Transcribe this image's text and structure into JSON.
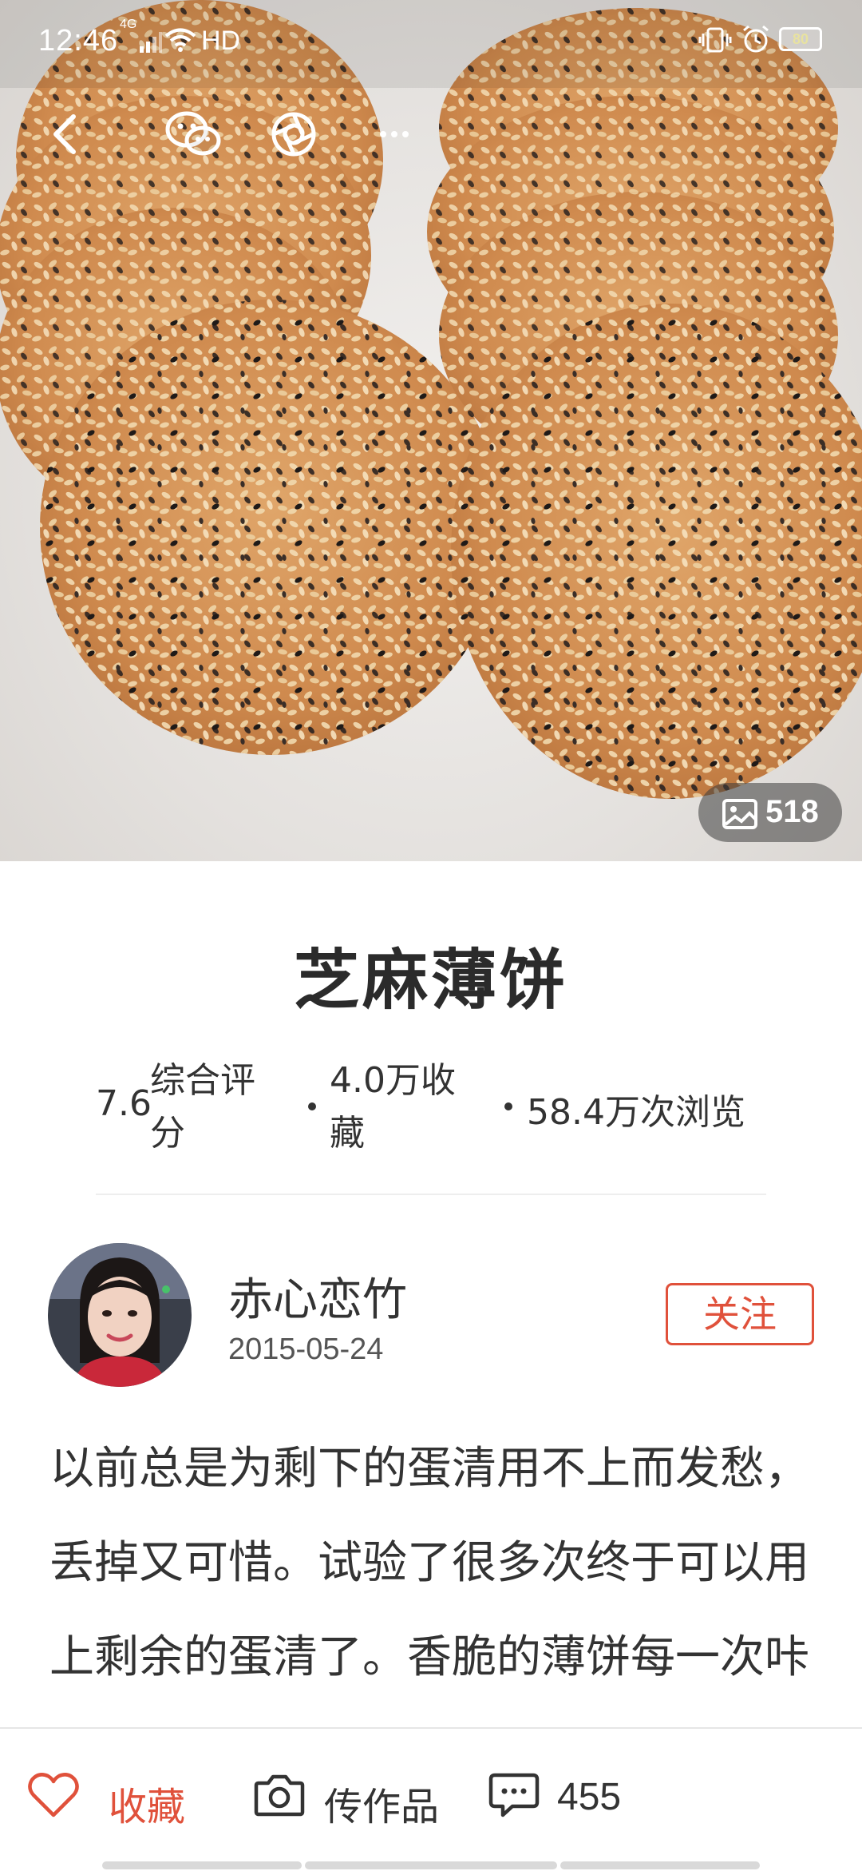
{
  "status_bar": {
    "time": "12:46",
    "network": "4G",
    "hd": "HD",
    "battery": "80"
  },
  "hero": {
    "photo_count": "518"
  },
  "recipe": {
    "title": "芝麻薄饼",
    "rating_value": "7.6",
    "rating_label": "综合评分",
    "favorites": "4.0万收藏",
    "views": "58.4万次浏览"
  },
  "author": {
    "name": "赤心恋竹",
    "date": "2015-05-24",
    "follow_label": "关注"
  },
  "description": "以前总是为剩下的蛋清用不上而发愁，丢掉又可惜。试验了很多次终于可以用上剩余的蛋清了。香脆的薄饼每一次咔嚓下去，空中立时都有香酥",
  "bottom_bar": {
    "favorite_label": "收藏",
    "upload_label": "传作品",
    "comment_count": "455"
  },
  "colors": {
    "accent": "#e0513b",
    "text": "#333333"
  }
}
